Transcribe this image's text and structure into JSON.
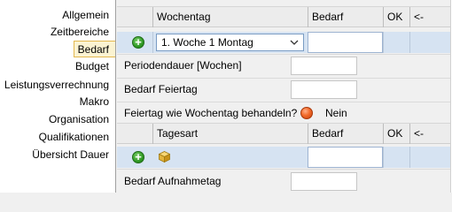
{
  "nav": {
    "items": [
      {
        "label": "Allgemein"
      },
      {
        "label": "Zeitbereiche"
      },
      {
        "label": "Bedarf"
      },
      {
        "label": "Budget"
      },
      {
        "label": "Leistungsverrechnung"
      },
      {
        "label": "Makro"
      },
      {
        "label": "Organisation"
      },
      {
        "label": "Qualifikationen"
      },
      {
        "label": "Übersicht Dauer"
      }
    ]
  },
  "grid1": {
    "headers": [
      "Wochentag",
      "Bedarf",
      "OK",
      "<-"
    ],
    "row": {
      "select_value": "1. Woche 1 Montag",
      "bedarf_value": ""
    }
  },
  "fields": {
    "periodendauer_label": "Periodendauer [Wochen]",
    "periodendauer_value": "",
    "bedarf_feiertag_label": "Bedarf Feiertag",
    "bedarf_feiertag_value": "",
    "feiertag_question": "Feiertag wie Wochentag behandeln?",
    "feiertag_answer": "Nein"
  },
  "grid2": {
    "headers": [
      "Tagesart",
      "Bedarf",
      "OK",
      "<-"
    ],
    "row": {
      "bedarf_value": ""
    }
  },
  "footer": {
    "bedarf_aufnahmetag_label": "Bedarf Aufnahmetag",
    "bedarf_aufnahmetag_value": ""
  },
  "colors": {
    "accent_row": "#d6e3f2",
    "active_nav_bg": "#fbf3d1",
    "active_nav_border": "#e3b84f",
    "add_icon": "#2f9a24",
    "radio_off": "#f26a2a"
  },
  "icons": {
    "add": "plus-circle-icon",
    "cube": "cube-icon",
    "dropdown": "chevron-down-icon",
    "radio": "radio-dot-icon"
  }
}
